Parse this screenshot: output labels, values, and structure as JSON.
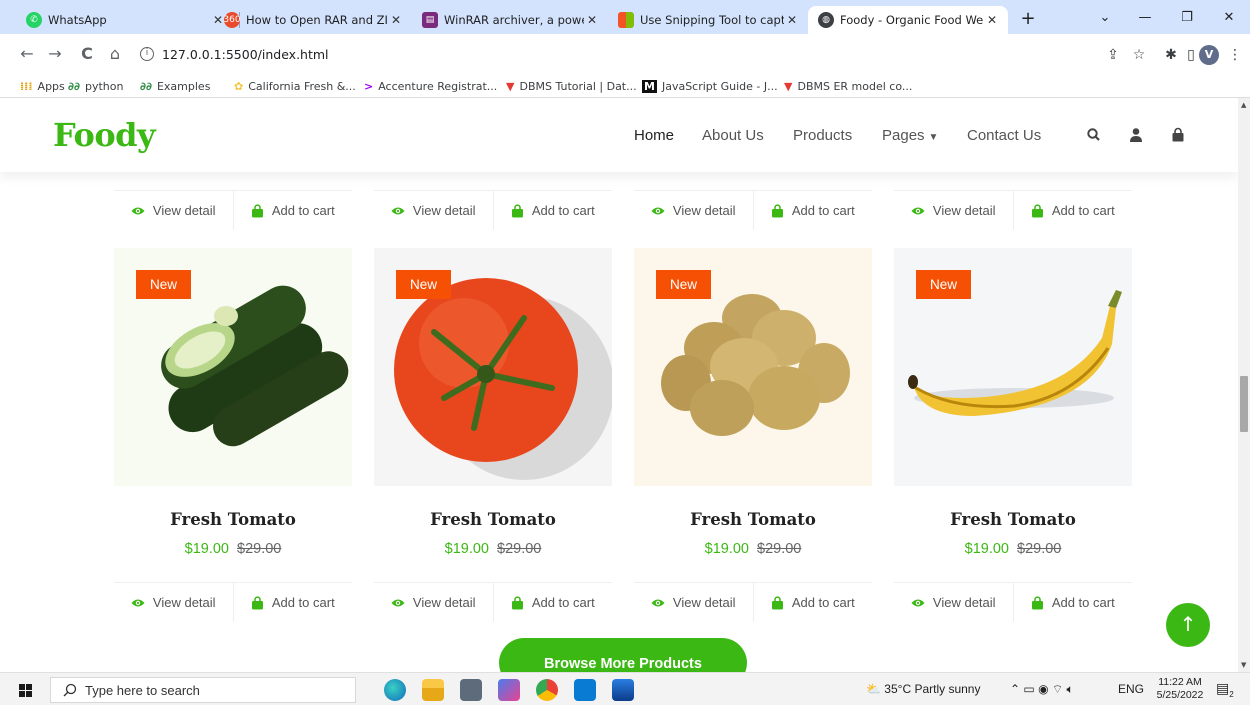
{
  "browser": {
    "tabs": [
      {
        "title": "WhatsApp",
        "close": "✕"
      },
      {
        "title": "How to Open RAR and ZIP Fi",
        "close": "✕"
      },
      {
        "title": "WinRAR archiver, a powerful",
        "close": "✕"
      },
      {
        "title": "Use Snipping Tool to capture",
        "close": "✕"
      },
      {
        "title": "Foody - Organic Food Webs",
        "close": "✕"
      }
    ],
    "url": "127.0.0.1:5500/index.html",
    "profile_initial": "V",
    "bookmarks": [
      {
        "label": "Apps",
        "icon": "apps-grid-icon"
      },
      {
        "label": "python",
        "icon": "geeksforgeeks-icon"
      },
      {
        "label": "Examples",
        "icon": "geeksforgeeks-icon"
      },
      {
        "label": "California Fresh &...",
        "icon": "flower-icon"
      },
      {
        "label": "Accenture Registrat...",
        "icon": "accenture-icon"
      },
      {
        "label": "DBMS Tutorial | Dat...",
        "icon": "dbms-icon"
      },
      {
        "label": "JavaScript Guide - J...",
        "icon": "mdn-icon"
      },
      {
        "label": "DBMS ER model co...",
        "icon": "dbms-icon"
      }
    ]
  },
  "site": {
    "logo": "Foody",
    "nav": [
      {
        "label": "Home"
      },
      {
        "label": "About Us"
      },
      {
        "label": "Products"
      },
      {
        "label": "Pages"
      },
      {
        "label": "Contact Us"
      }
    ]
  },
  "actions": {
    "view": "View detail",
    "cart": "Add to cart"
  },
  "products": [
    {
      "badge": "New",
      "name": "Fresh Tomato",
      "price": "$19.00",
      "old_price": "$29.00",
      "image": "cucumber",
      "bg": "#f7fbf1"
    },
    {
      "badge": "New",
      "name": "Fresh Tomato",
      "price": "$19.00",
      "old_price": "$29.00",
      "image": "tomato",
      "bg": "#f5f5f5"
    },
    {
      "badge": "New",
      "name": "Fresh Tomato",
      "price": "$19.00",
      "old_price": "$29.00",
      "image": "potato",
      "bg": "#fdf6ea"
    },
    {
      "badge": "New",
      "name": "Fresh Tomato",
      "price": "$19.00",
      "old_price": "$29.00",
      "image": "banana",
      "bg": "#f4f6f8"
    }
  ],
  "browse_button": "Browse More Products",
  "colors": {
    "primary": "#3cb815",
    "badge": "#f65005"
  },
  "taskbar": {
    "search_placeholder": "Type here to search",
    "weather": "35°C  Partly sunny",
    "language": "ENG",
    "time": "11:22 AM",
    "date": "5/25/2022",
    "notification_count": "2"
  }
}
